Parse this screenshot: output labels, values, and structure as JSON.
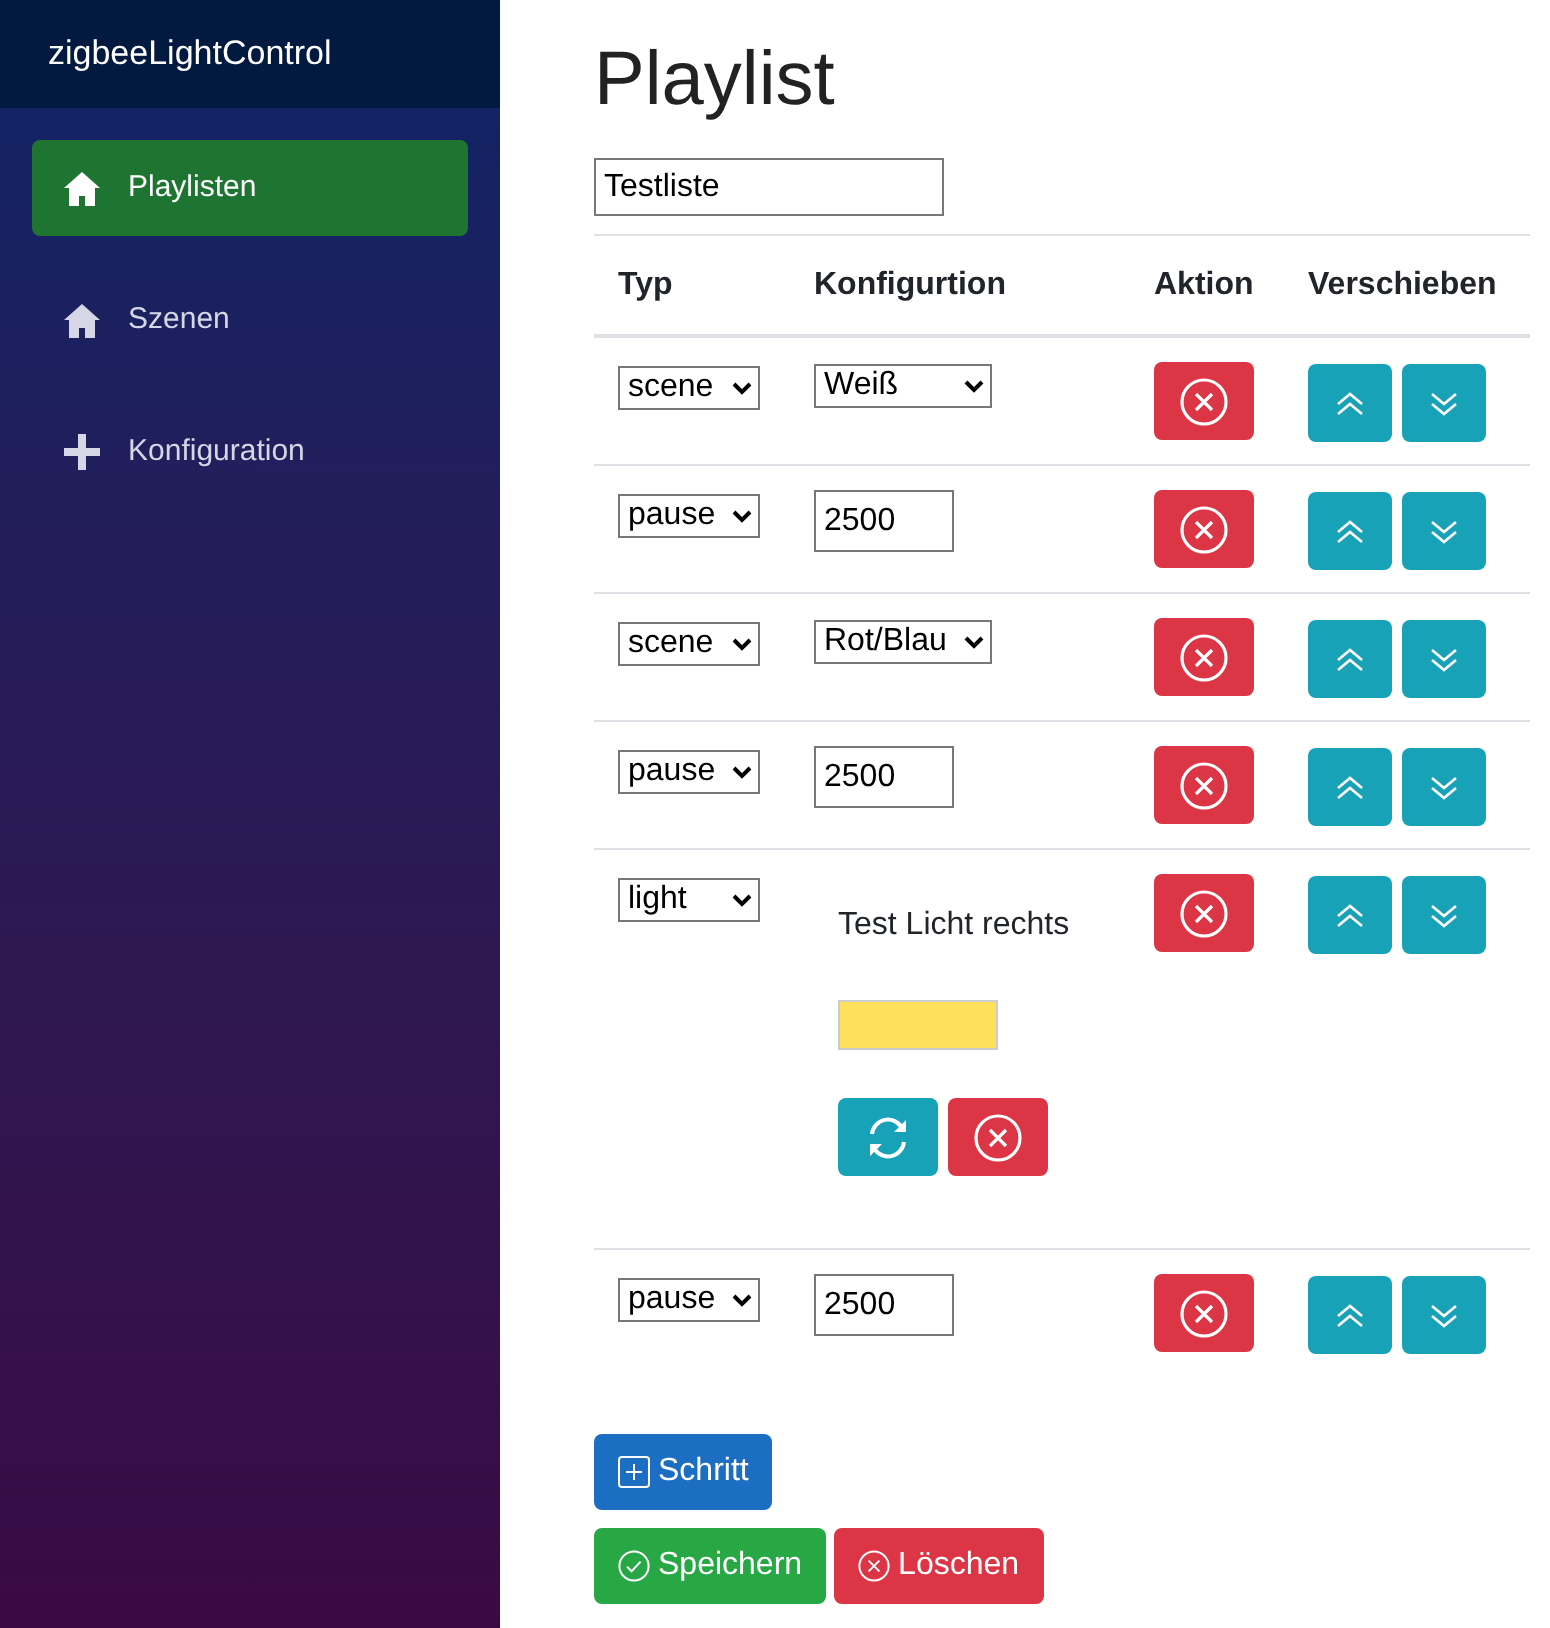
{
  "app_title": "zigbeeLightControl",
  "sidebar": {
    "items": [
      {
        "label": "Playlisten",
        "selected": true
      },
      {
        "label": "Szenen",
        "selected": false
      },
      {
        "label": "Konfiguration",
        "selected": false
      }
    ]
  },
  "page_title": "Playlist",
  "playlist_name": "Testliste",
  "table": {
    "columns": [
      "Typ",
      "Konfigurtion",
      "Aktion",
      "Verschieben"
    ],
    "rows": [
      {
        "kind": "scene",
        "type": "scene",
        "value": "Weiß"
      },
      {
        "kind": "pause",
        "type": "pause",
        "value": "2500"
      },
      {
        "kind": "scene",
        "type": "scene",
        "value": "Rot/Blau"
      },
      {
        "kind": "pause",
        "type": "pause",
        "value": "2500"
      },
      {
        "kind": "light",
        "type": "light",
        "label": "Test Licht rechts",
        "color": "#ffe05a"
      },
      {
        "kind": "pause",
        "type": "pause",
        "value": "2500"
      }
    ]
  },
  "buttons": {
    "add": "Schritt",
    "save": "Speichern",
    "delete": "Löschen"
  }
}
